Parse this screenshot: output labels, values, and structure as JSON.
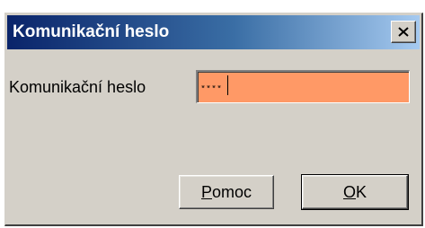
{
  "dialog": {
    "title": "Komunikační heslo",
    "close_icon": "close-x-icon",
    "field_label": "Komunikační heslo",
    "password_value": "****",
    "password_bg_color": "#ff9966",
    "title_bar_colors": [
      "#0a246a",
      "#a6caf0"
    ]
  },
  "buttons": {
    "help": {
      "label_first": "P",
      "label_rest": "omoc"
    },
    "ok": {
      "label_first": "O",
      "label_rest": "K"
    }
  }
}
